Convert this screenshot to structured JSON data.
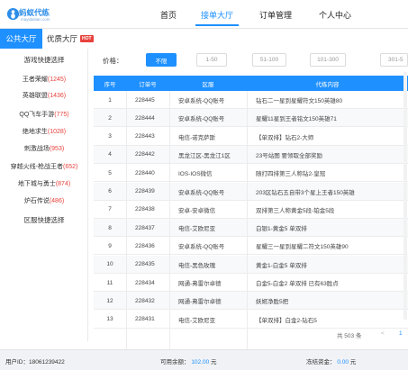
{
  "header": {
    "logo_text": "蚂蚁代练",
    "logo_sub": "mayidaitian.com",
    "nav": [
      "首页",
      "接单大厅",
      "订单管理",
      "个人中心"
    ],
    "active_nav": "接单大厅"
  },
  "tabs": {
    "public": "公共大厅",
    "quality": "优质大厅",
    "hot_badge": "HOT"
  },
  "sidebar": {
    "game_header": "游戏快捷选择",
    "games": [
      {
        "name": "王者荣耀",
        "count": "(1245)"
      },
      {
        "name": "英雄联盟",
        "count": "(1436)"
      },
      {
        "name": "QQ飞车手游",
        "count": "(775)"
      },
      {
        "name": "绝地求生",
        "count": "(1028)"
      },
      {
        "name": "刺激战场",
        "count": "(953)"
      },
      {
        "name": "穿越火线-枪战王者",
        "count": "(652)"
      },
      {
        "name": "地下城与勇士",
        "count": "(874)"
      },
      {
        "name": "炉石传说",
        "count": "(486)"
      }
    ],
    "region_header": "区服快捷选择"
  },
  "filter": {
    "label": "价格：",
    "options": [
      "不限",
      "1-50",
      "51-100",
      "101-300",
      "301-5"
    ],
    "selected": "不限"
  },
  "table": {
    "headers": [
      "序号",
      "订单号",
      "区服",
      "代练内容"
    ],
    "rows": [
      {
        "idx": "1",
        "order": "228445",
        "region": "安卓系统-QQ账号",
        "content": "钻石二一星到星耀符文150英雄80"
      },
      {
        "idx": "2",
        "order": "228444",
        "region": "安卓系统-QQ账号",
        "content": "星耀11星到王者铭文150英雄71"
      },
      {
        "idx": "3",
        "order": "228443",
        "region": "电信-诺克萨斯",
        "content": "【单双排】钻石2-大师"
      },
      {
        "idx": "4",
        "order": "228442",
        "region": "黑龙江区-黑龙江1区",
        "content": "23号站图 要领取全部奖励"
      },
      {
        "idx": "5",
        "order": "228440",
        "region": "IOS-IOS微信",
        "content": "随打四排第三人称钻2-皇冠"
      },
      {
        "idx": "6",
        "order": "228439",
        "region": "安卓系统-QQ账号",
        "content": "203区钻石五自带3个星上王者150英雄"
      },
      {
        "idx": "7",
        "order": "228438",
        "region": "安卓-安卓微信",
        "content": "双排第三人称黄金5段-铂金5段"
      },
      {
        "idx": "8",
        "order": "228437",
        "region": "电信-艾欧尼亚",
        "content": "白银1-黄金5 单双排"
      },
      {
        "idx": "9",
        "order": "228436",
        "region": "安卓系统-QQ账号",
        "content": "星耀三一星到星耀二符文150英雄90"
      },
      {
        "idx": "10",
        "order": "228435",
        "region": "电信-黑色玫瑰",
        "content": "黄金1-白金5 单双排"
      },
      {
        "idx": "11",
        "order": "228434",
        "region": "网通-弗雷尔卓德",
        "content": "白金5-白金2 单双排 已有63胜点"
      },
      {
        "idx": "12",
        "order": "228432",
        "region": "网通-弗雷尔卓德",
        "content": "妖姬净胜5把"
      },
      {
        "idx": "13",
        "order": "228431",
        "region": "电信-艾欧尼亚",
        "content": "【单双排】白金2-钻石5"
      }
    ]
  },
  "pager": {
    "total": "共 503 条",
    "prev": "<",
    "page": "1"
  },
  "footer": {
    "user_label": "用户ID：",
    "user_id": "18061239422",
    "balance_label": "可用余额：",
    "balance": "102.00",
    "balance_unit": "元",
    "frozen_label": "冻结资金：",
    "frozen": "0.00",
    "frozen_unit": "元"
  },
  "colors": {
    "accent": "#1e90ff",
    "count_red": "#e8413c"
  }
}
